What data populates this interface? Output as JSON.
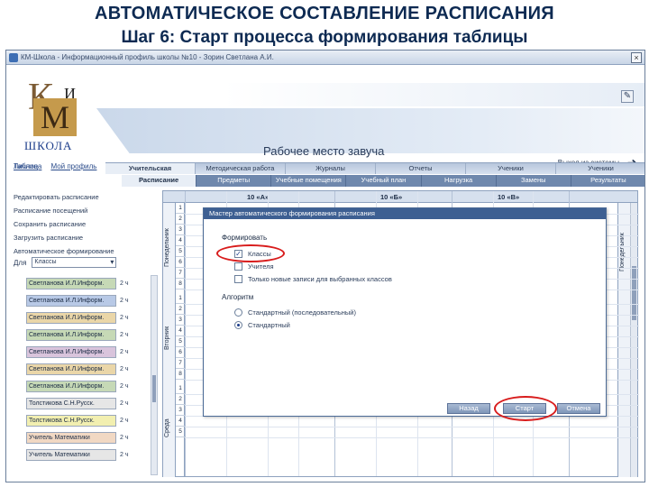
{
  "slide": {
    "title": "АВТОМАТИЧЕСКОЕ СОСТАВЛЕНИЕ РАСПИСАНИЯ",
    "subtitle": "Шаг 6: Старт процесса формирования таблицы"
  },
  "window": {
    "title": "КМ-Школа - Информационный профиль школы №10 - Зорин Светлана А.И.",
    "close_label": "×"
  },
  "logo": {
    "k": "К",
    "i": "И",
    "m": "М",
    "school": "ШКОЛА"
  },
  "header": {
    "workplace": "Рабочее место завуча",
    "exit": "Выход из системы",
    "links": [
      "Личное",
      "Мой профиль"
    ],
    "table_link": "Таблица",
    "print_icon": "✎"
  },
  "tabs": [
    "Учительская",
    "Методическая работа",
    "Журналы",
    "Отчеты",
    "Ученики",
    "Ученики"
  ],
  "tabs_active_index": 0,
  "subtabs": [
    "Расписание",
    "Предметы",
    "Учебные помещения",
    "Учебный план",
    "Нагрузка",
    "Замены",
    "Результаты"
  ],
  "subtabs_active_index": 0,
  "sidebar": {
    "menu": [
      "Редактировать расписание",
      "Расписание посещений",
      "Сохранить расписание",
      "Загрузить расписание",
      "Автоматическое формирование"
    ],
    "class_label": "Для",
    "class_value": "Классы",
    "teachers": [
      {
        "name": "Светланова И.Л.Информ.",
        "hours": "2 ч",
        "color": "#c6d9b6"
      },
      {
        "name": "Светланова И.Л.Информ.",
        "hours": "2 ч",
        "color": "#b8c9e6"
      },
      {
        "name": "Светланова И.Л.Информ.",
        "hours": "2 ч",
        "color": "#ead6a8"
      },
      {
        "name": "Светланова И.Л.Информ.",
        "hours": "2 ч",
        "color": "#c6d9b6"
      },
      {
        "name": "Светланова И.Л.Информ.",
        "hours": "2 ч",
        "color": "#d9c4dc"
      },
      {
        "name": "Светланова И.Л.Информ.",
        "hours": "2 ч",
        "color": "#ead6a8"
      },
      {
        "name": "Светланова И.Л.Информ.",
        "hours": "2 ч",
        "color": "#c6d9b6"
      },
      {
        "name": "Толстикова С.Н.Русск.",
        "hours": "2 ч",
        "color": "#e6e6e6"
      },
      {
        "name": "Толстикова С.Н.Русск.",
        "hours": "2 ч",
        "color": "#f2efb0"
      },
      {
        "name": "Учитель Математики",
        "hours": "2 ч",
        "color": "#f1d8c3"
      },
      {
        "name": "Учитель Математики",
        "hours": "2 ч",
        "color": "#e6e6e6"
      }
    ]
  },
  "grid": {
    "classes": [
      "10 «А»",
      "10 «Б»",
      "10 «В»"
    ],
    "days_left": [
      "Понедельник",
      "Вторник",
      "Среда"
    ],
    "day_right": "Понедельник",
    "lessons": [
      "1",
      "2",
      "3",
      "4",
      "5",
      "6",
      "7",
      "8",
      "1",
      "2",
      "3",
      "4",
      "5",
      "6",
      "7",
      "8",
      "1",
      "2",
      "3",
      "4",
      "5"
    ]
  },
  "dialog": {
    "title": "Мастер автоматического формирования расписания",
    "form_label": "Формировать",
    "form_options": [
      {
        "label": "Классы",
        "checked": true
      },
      {
        "label": "Учителя",
        "checked": false
      },
      {
        "label": "Только новые записи для выбранных классов",
        "checked": false
      }
    ],
    "algo_label": "Алгоритм",
    "algo_options": [
      {
        "label": "Стандартный (последовательный)",
        "selected": false
      },
      {
        "label": "Стандартный",
        "selected": true
      }
    ],
    "buttons": {
      "back": "Назад",
      "start": "Старт",
      "cancel": "Отмена"
    }
  },
  "colors": {
    "accent": "#d81c1c",
    "title": "#0d2a52",
    "tab_bar": "#6f88ad"
  }
}
